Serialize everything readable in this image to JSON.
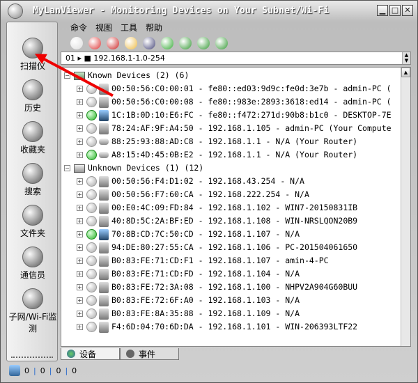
{
  "window": {
    "title": "MyLanViewer - Monitoring Devices on Your Subnet/Wi-Fi",
    "minimize": "▁",
    "maximize": "□",
    "close": "✕"
  },
  "menu": [
    "命令",
    "视图",
    "工具",
    "帮助"
  ],
  "toolbar": [
    "import-icon",
    "stop-icon",
    "delete-icon",
    "folder-icon",
    "save-icon",
    "search-icon",
    "back-icon",
    "forward-icon",
    "refresh-icon"
  ],
  "address": {
    "value": "01 ▸ ■ 192.168.1-1.0-254"
  },
  "sidebar": [
    {
      "label": "扫描仪",
      "icon": "scanner-icon"
    },
    {
      "label": "历史",
      "icon": "history-icon"
    },
    {
      "label": "收藏夹",
      "icon": "favorites-icon"
    },
    {
      "label": "搜索",
      "icon": "search-icon"
    },
    {
      "label": "文件夹",
      "icon": "folder-icon"
    },
    {
      "label": "通信员",
      "icon": "messenger-icon"
    },
    {
      "label": "子网/Wi-Fi监测",
      "icon": "wifi-monitor-icon"
    }
  ],
  "groups": [
    {
      "label": "Known Devices (2) (6)",
      "items": [
        {
          "text": "00:50:56:C0:00:01 - fe80::ed03:9d9c:fe0d:3e7b - admin-PC (",
          "online": false,
          "type": "pc"
        },
        {
          "text": "00:50:56:C0:00:08 - fe80::983e:2893:3618:ed14 - admin-PC (",
          "online": false,
          "type": "pc"
        },
        {
          "text": "1C:1B:0D:10:E6:FC - fe80::f472:271d:90b8:b1c0 - DESKTOP-7E",
          "online": true,
          "type": "pc-blue"
        },
        {
          "text": "78:24:AF:9F:A4:50 - 192.168.1.105 - admin-PC (Your Compute",
          "online": false,
          "type": "pc"
        },
        {
          "text": "88:25:93:88:AD:C8 - 192.168.1.1 - N/A (Your Router)",
          "online": false,
          "type": "router"
        },
        {
          "text": "A8:15:4D:45:0B:E2 - 192.168.1.1 - N/A (Your Router)",
          "online": true,
          "type": "router"
        }
      ]
    },
    {
      "label": "Unknown Devices (1) (12)",
      "items": [
        {
          "text": "00:50:56:F4:D1:02 - 192.168.43.254 - N/A",
          "online": false,
          "type": "pc"
        },
        {
          "text": "00:50:56:F7:60:CA - 192.168.222.254 - N/A",
          "online": false,
          "type": "pc"
        },
        {
          "text": "00:E0:4C:09:FD:84 - 192.168.1.102 - WIN7-20150831IB",
          "online": false,
          "type": "pc"
        },
        {
          "text": "40:8D:5C:2A:BF:ED - 192.168.1.108 - WIN-NRSLQON20B9",
          "online": false,
          "type": "pc"
        },
        {
          "text": "70:8B:CD:7C:50:CD - 192.168.1.107 - N/A",
          "online": true,
          "type": "pc-blue"
        },
        {
          "text": "94:DE:80:27:55:CA - 192.168.1.106 - PC-201504061650",
          "online": false,
          "type": "pc"
        },
        {
          "text": "B0:83:FE:71:CD:F1 - 192.168.1.107 - amin-4-PC",
          "online": false,
          "type": "pc"
        },
        {
          "text": "B0:83:FE:71:CD:FD - 192.168.1.104 - N/A",
          "online": false,
          "type": "pc"
        },
        {
          "text": "B0:83:FE:72:3A:08 - 192.168.1.100 - NHPV2A904G60BUU",
          "online": false,
          "type": "pc"
        },
        {
          "text": "B0:83:FE:72:6F:A0 - 192.168.1.103 - N/A",
          "online": false,
          "type": "pc"
        },
        {
          "text": "B0:83:FE:8A:35:88 - 192.168.1.109 - N/A",
          "online": false,
          "type": "pc"
        },
        {
          "text": "F4:6D:04:70:6D:DA - 192.168.1.101 - WIN-206393LTF22",
          "online": false,
          "type": "pc"
        }
      ]
    }
  ],
  "tabs": [
    {
      "label": "设备",
      "active": true
    },
    {
      "label": "事件",
      "active": false
    }
  ],
  "status": [
    "0",
    "0",
    "0",
    "0"
  ]
}
